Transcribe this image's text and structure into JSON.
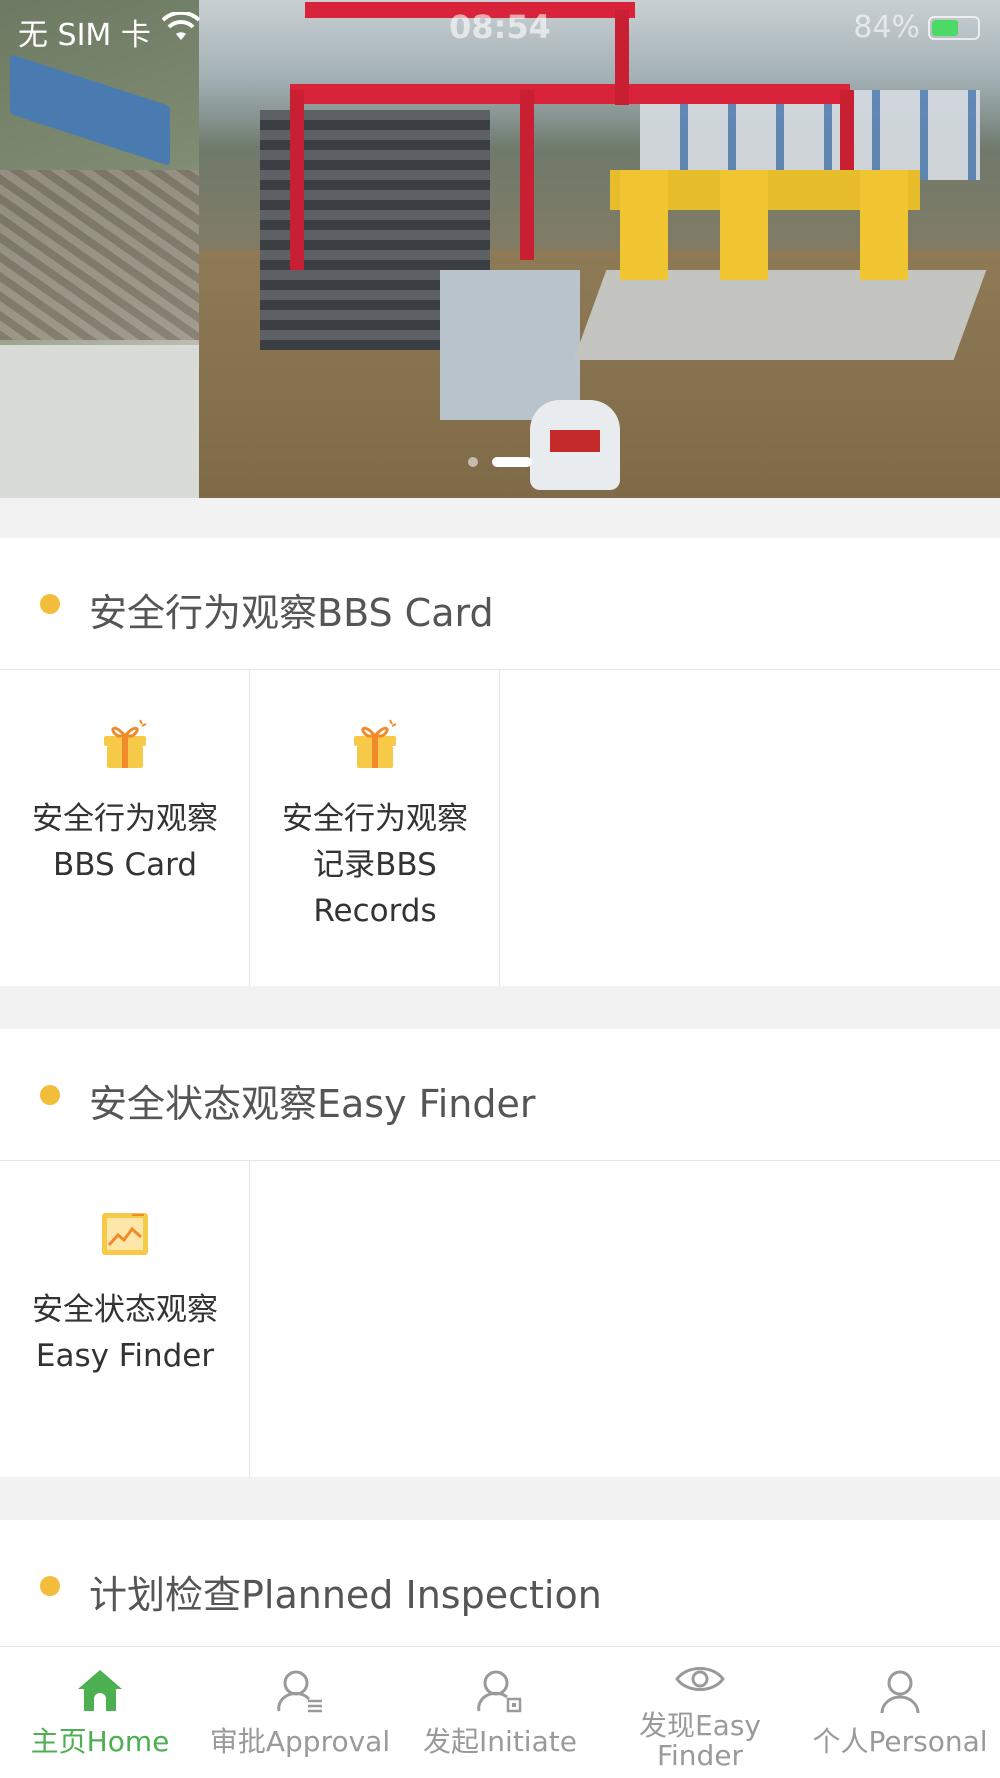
{
  "status_bar": {
    "carrier": "无 SIM 卡",
    "time": "08:54",
    "battery": "84%"
  },
  "banner": {
    "slides": 2,
    "active_slide": 2
  },
  "sections": [
    {
      "title": "安全行为观察BBS Card",
      "items": [
        {
          "label": "安全行为观察BBS Card",
          "icon": "gift-icon"
        },
        {
          "label": "安全行为观察记录BBS Records",
          "icon": "gift-icon"
        }
      ]
    },
    {
      "title": "安全状态观察Easy Finder",
      "items": [
        {
          "label": "安全状态观察Easy Finder",
          "icon": "picture-chart-icon"
        }
      ]
    },
    {
      "title": "计划检查Planned Inspection",
      "items": []
    }
  ],
  "tabbar": {
    "tabs": [
      {
        "label": "主页Home",
        "icon": "home-icon",
        "active": true
      },
      {
        "label": "审批Approval",
        "icon": "user-list-icon",
        "active": false
      },
      {
        "label": "发起Initiate",
        "icon": "user-add-icon",
        "active": false
      },
      {
        "label": "发现Easy Finder",
        "icon": "eye-icon",
        "active": false
      },
      {
        "label": "个人Personal",
        "icon": "user-icon",
        "active": false
      }
    ]
  },
  "colors": {
    "accent_green": "#4caf50",
    "bullet_yellow": "#f2bd3b",
    "icon_yellow": "#f7c948",
    "icon_orange": "#f08a2a"
  }
}
